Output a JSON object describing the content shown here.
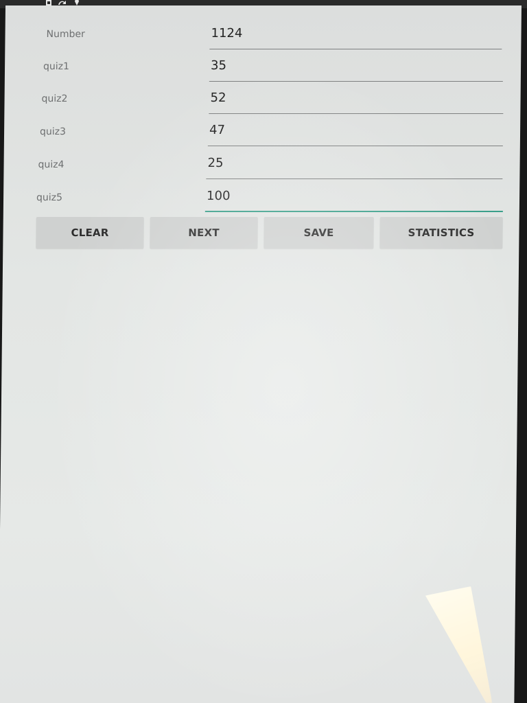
{
  "form": {
    "fields": [
      {
        "label": "Number",
        "value": "1124"
      },
      {
        "label": "quiz1",
        "value": "35"
      },
      {
        "label": "quiz2",
        "value": "52"
      },
      {
        "label": "quiz3",
        "value": "47"
      },
      {
        "label": "quiz4",
        "value": "25"
      },
      {
        "label": "quiz5",
        "value": "100"
      }
    ]
  },
  "buttons": {
    "clear": "CLEAR",
    "next": "NEXT",
    "save": "SAVE",
    "statistics": "STATISTICS"
  },
  "colors": {
    "accent": "#3a9f8a",
    "screen_background": "#e3e6e4",
    "button_background": "#cfd1d0"
  },
  "status_icons": [
    "sim-card-icon",
    "sync-icon",
    "location-pin-icon"
  ]
}
